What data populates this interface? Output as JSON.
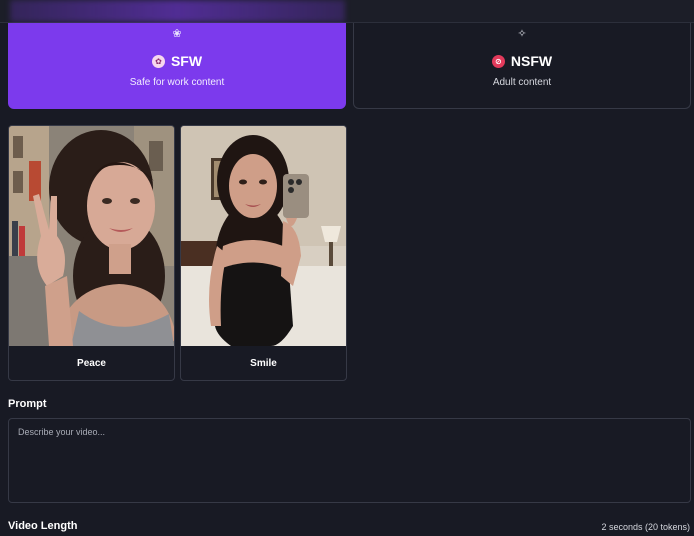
{
  "modes": {
    "sfw": {
      "title": "SFW",
      "subtitle": "Safe for work content",
      "top_icon": "sparkle-flower-icon",
      "badge_icon": "flower-icon",
      "selected": true
    },
    "nsfw": {
      "title": "NSFW",
      "subtitle": "Adult content",
      "top_icon": "sparkles-icon",
      "badge_icon": "no-entry-icon",
      "selected": false
    }
  },
  "styles": [
    {
      "label": "Peace",
      "image": "woman-peace-sign-street-photo"
    },
    {
      "label": "Smile",
      "image": "woman-mirror-selfie-bedroom-photo"
    }
  ],
  "prompt": {
    "label": "Prompt",
    "placeholder": "Describe your video...",
    "value": ""
  },
  "video_length": {
    "label": "Video Length",
    "value": "2 seconds (20 tokens)"
  },
  "colors": {
    "accent": "#7c3aed",
    "background": "#181a24",
    "border": "#363946",
    "nsfw_badge": "#e23a5b"
  }
}
